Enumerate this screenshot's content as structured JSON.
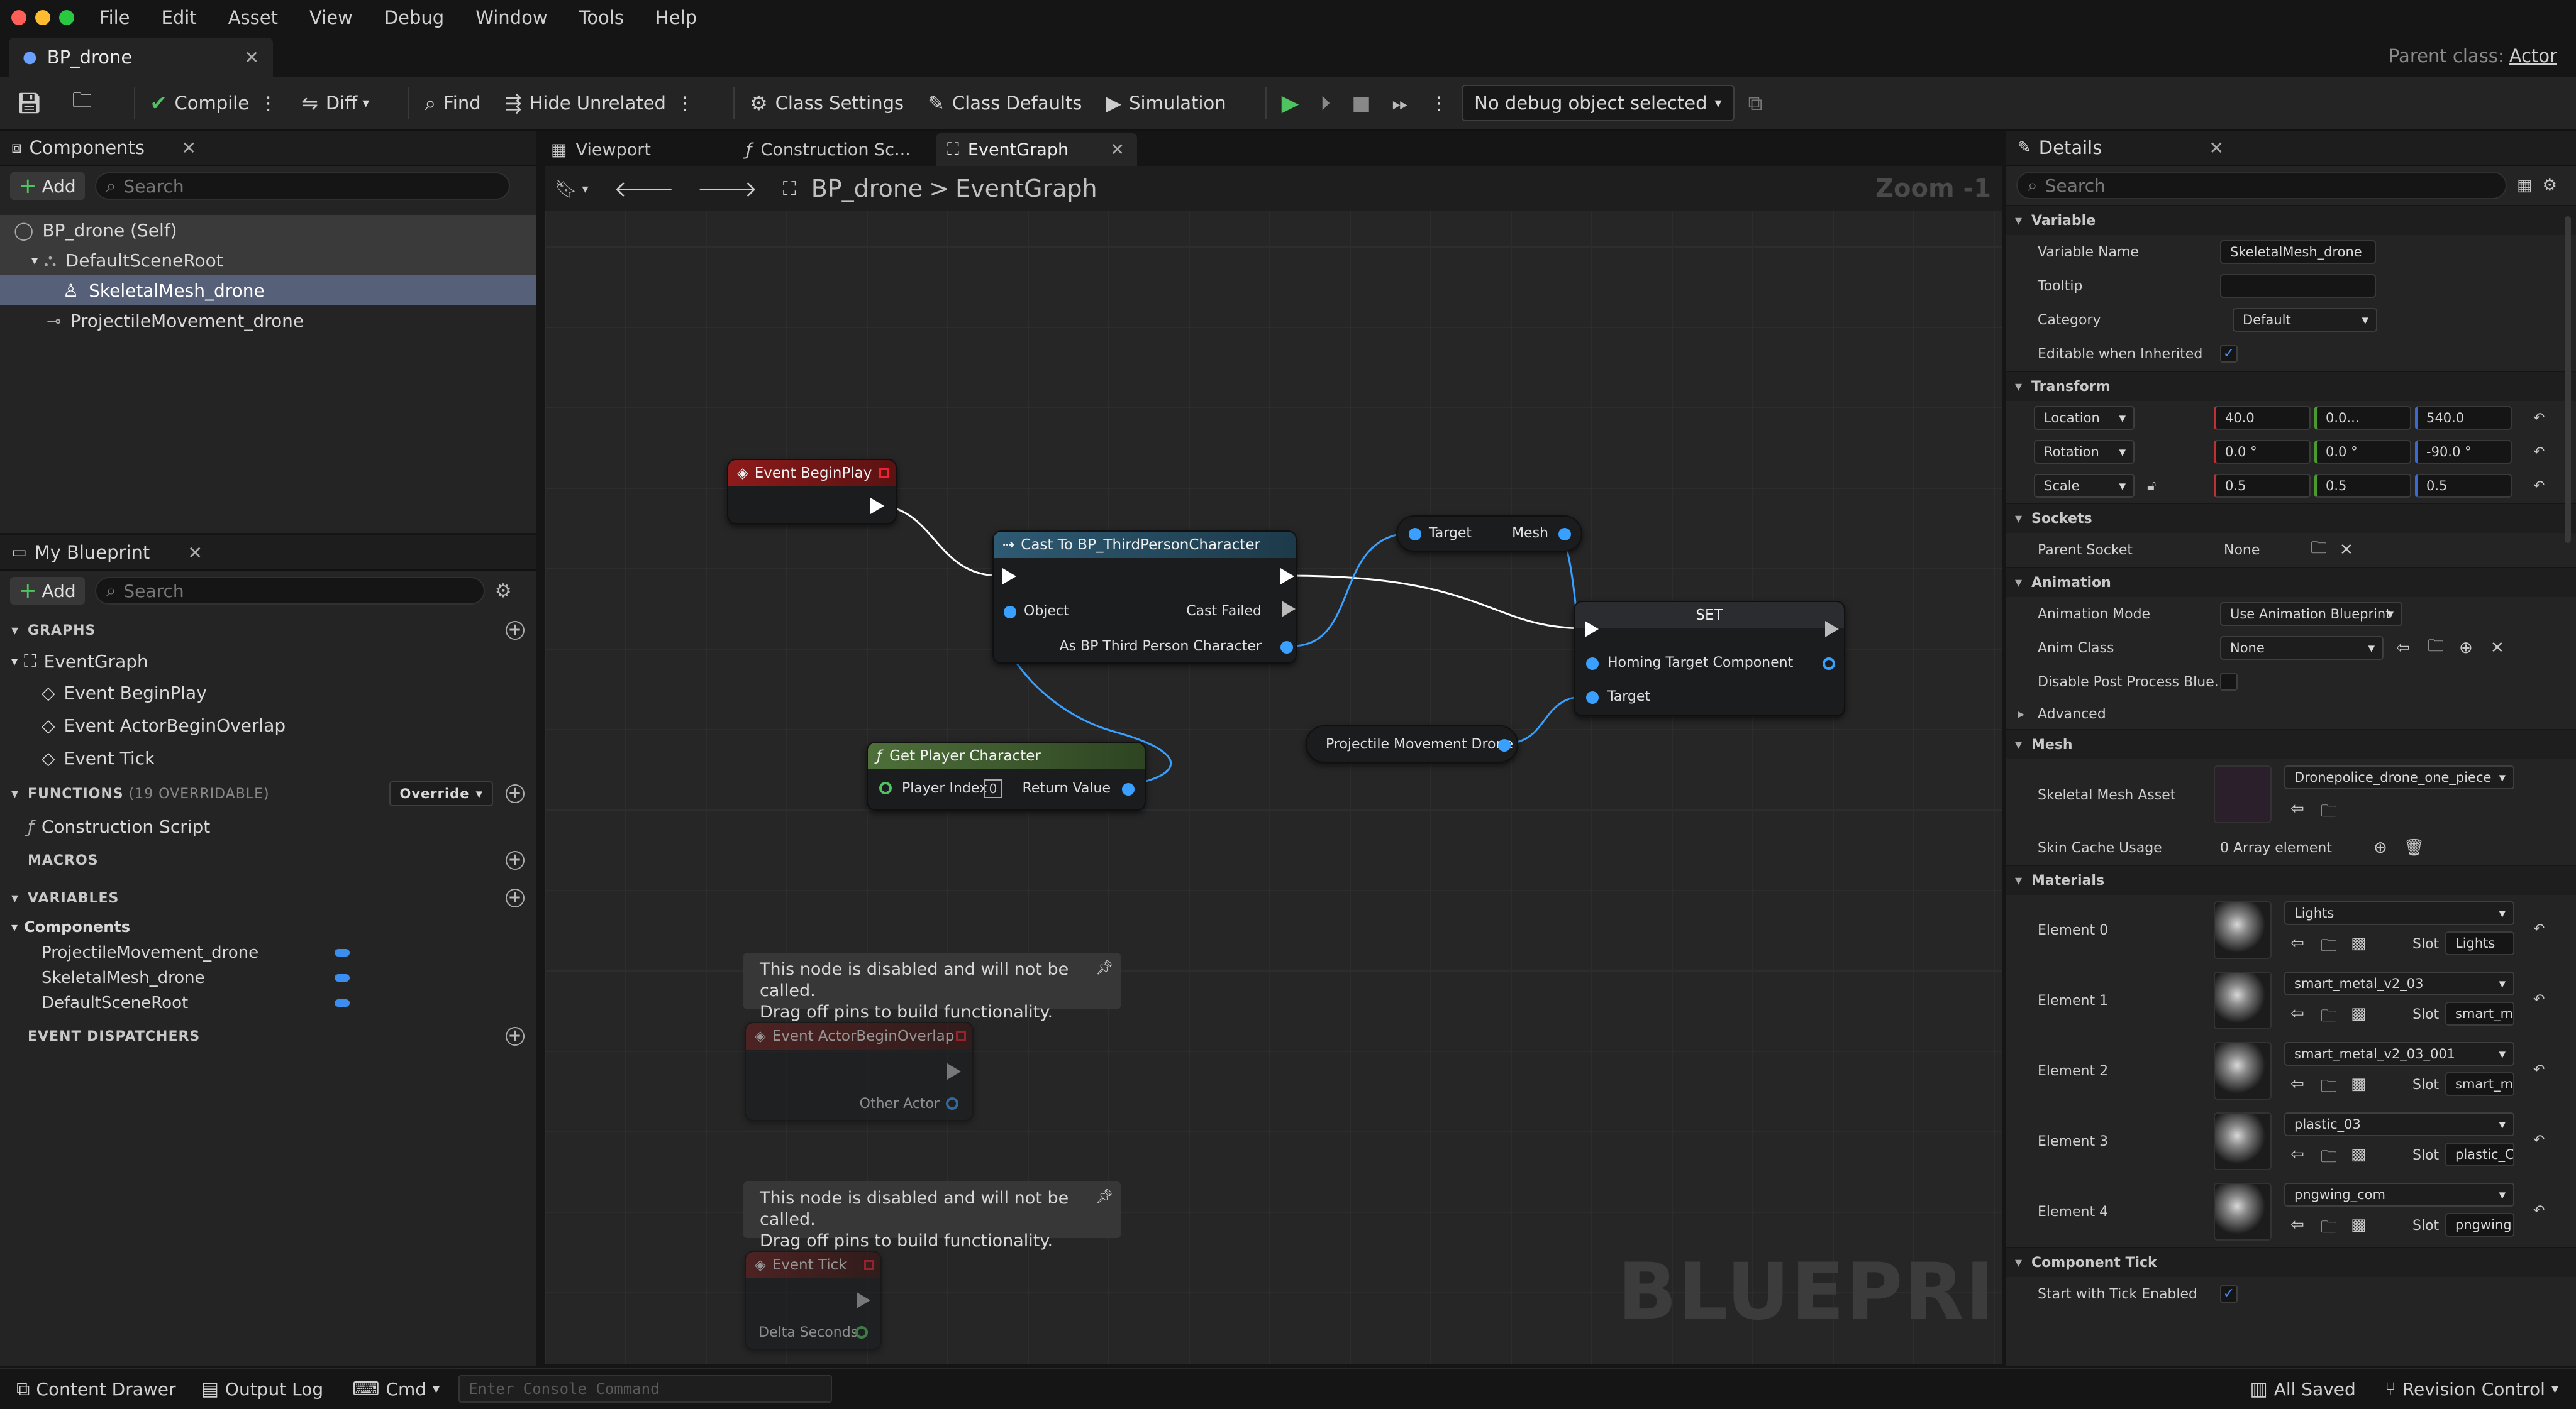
{
  "menu": [
    "File",
    "Edit",
    "Asset",
    "View",
    "Debug",
    "Window",
    "Tools",
    "Help"
  ],
  "doc_tab": {
    "title": "BP_drone"
  },
  "parent_class": {
    "label": "Parent class:",
    "value": "Actor"
  },
  "toolbar": {
    "compile": "Compile",
    "diff": "Diff",
    "find": "Find",
    "hide_unrelated": "Hide Unrelated",
    "class_settings": "Class Settings",
    "class_defaults": "Class Defaults",
    "simulation": "Simulation",
    "debug_select": "No debug object selected"
  },
  "components": {
    "title": "Components",
    "add": "Add",
    "search_placeholder": "Search",
    "items": [
      "BP_drone (Self)",
      "DefaultSceneRoot",
      "SkeletalMesh_drone",
      "ProjectileMovement_drone"
    ]
  },
  "my_blueprint": {
    "title": "My Blueprint",
    "add": "Add",
    "search_placeholder": "Search",
    "graphs_header": "GRAPHS",
    "event_graph": "EventGraph",
    "events": [
      "Event BeginPlay",
      "Event ActorBeginOverlap",
      "Event Tick"
    ],
    "functions_header": "FUNCTIONS",
    "functions_count": "(19 OVERRIDABLE)",
    "override": "Override",
    "construction_script": "Construction Script",
    "macros_header": "MACROS",
    "variables_header": "VARIABLES",
    "components_group": "Components",
    "variables": [
      "ProjectileMovement_drone",
      "SkeletalMesh_drone",
      "DefaultSceneRoot"
    ],
    "dispatchers_header": "EVENT DISPATCHERS"
  },
  "graph_tabs": {
    "viewport": "Viewport",
    "construction": "Construction Sc...",
    "event_graph": "EventGraph"
  },
  "breadcrumb": {
    "root": "BP_drone",
    "sep": ">",
    "current": "EventGraph"
  },
  "zoom": "Zoom -1",
  "watermark": "BLUEPRINT",
  "nodes": {
    "begin_play": "Event BeginPlay",
    "cast_title": "Cast To BP_ThirdPersonCharacter",
    "cast_object": "Object",
    "cast_failed": "Cast Failed",
    "cast_as": "As BP Third Person Character",
    "mesh_target": "Target",
    "mesh_out": "Mesh",
    "set_title": "SET",
    "set_homing": "Homing Target Component",
    "set_target": "Target",
    "projectile": "Projectile Movement Drone",
    "get_player": "Get Player Character",
    "player_index": "Player Index",
    "player_index_value": "0",
    "return_value": "Return Value",
    "comment_text_1": "This node is disabled and will not be called.",
    "comment_text_2": "Drag off pins to build functionality.",
    "overlap_title": "Event ActorBeginOverlap",
    "other_actor": "Other Actor",
    "tick_title": "Event Tick",
    "delta_seconds": "Delta Seconds"
  },
  "details": {
    "title": "Details",
    "search_placeholder": "Search",
    "variable_section": "Variable",
    "variable_name_label": "Variable Name",
    "variable_name_value": "SkeletalMesh_drone",
    "tooltip_label": "Tooltip",
    "category_label": "Category",
    "category_value": "Default",
    "editable_label": "Editable when Inherited",
    "transform_section": "Transform",
    "location": "Location",
    "loc_x": "40.0",
    "loc_y": "0.0...",
    "loc_z": "540.0",
    "rotation": "Rotation",
    "rot_x": "0.0 °",
    "rot_y": "0.0 °",
    "rot_z": "-90.0 °",
    "scale": "Scale",
    "scl_x": "0.5",
    "scl_y": "0.5",
    "scl_z": "0.5",
    "sockets_section": "Sockets",
    "parent_socket_label": "Parent Socket",
    "parent_socket_value": "None",
    "animation_section": "Animation",
    "anim_mode_label": "Animation Mode",
    "anim_mode_value": "Use Animation Blueprint",
    "anim_class_label": "Anim Class",
    "anim_class_value": "None",
    "disable_pp_label": "Disable Post Process Blue...",
    "advanced": "Advanced",
    "mesh_section": "Mesh",
    "skeletal_mesh_label": "Skeletal Mesh Asset",
    "skeletal_mesh_value": "Dronepolice_drone_one_piece",
    "skin_cache_label": "Skin Cache Usage",
    "skin_cache_value": "0 Array element",
    "materials_section": "Materials",
    "slot_label": "Slot",
    "materials": [
      {
        "label": "Element 0",
        "value": "Lights",
        "slot": "Lights"
      },
      {
        "label": "Element 1",
        "value": "smart_metal_v2_03",
        "slot": "smart_m"
      },
      {
        "label": "Element 2",
        "value": "smart_metal_v2_03_001",
        "slot": "smart_m"
      },
      {
        "label": "Element 3",
        "value": "plastic_03",
        "slot": "plastic_C"
      },
      {
        "label": "Element 4",
        "value": "pngwing_com",
        "slot": "pngwing"
      }
    ],
    "component_tick_section": "Component Tick",
    "start_tick_label": "Start with Tick Enabled"
  },
  "bottom": {
    "content_drawer": "Content Drawer",
    "output_log": "Output Log",
    "cmd": "Cmd",
    "console_placeholder": "Enter Console Command",
    "all_saved": "All Saved",
    "revision_control": "Revision Control"
  }
}
